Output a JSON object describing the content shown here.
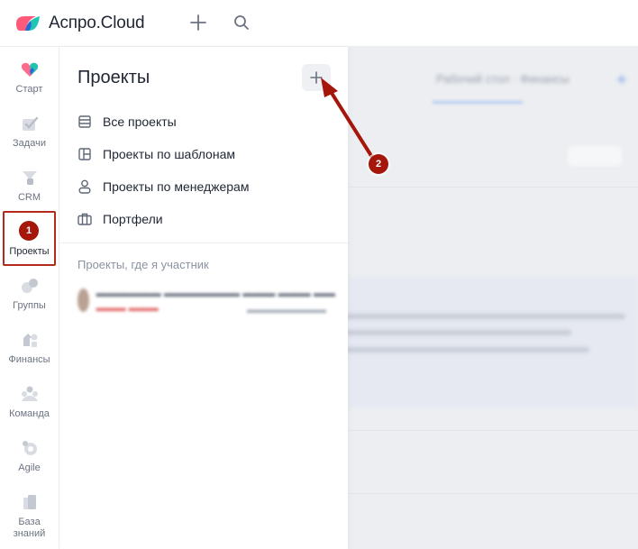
{
  "header": {
    "app_name": "Аспро.Cloud",
    "plus_icon": "plus-icon",
    "search_icon": "search-icon"
  },
  "rail": {
    "items": [
      {
        "label": "Старт",
        "icon": "heart-start-icon"
      },
      {
        "label": "Задачи",
        "icon": "tasks-icon"
      },
      {
        "label": "CRM",
        "icon": "crm-funnel-icon"
      },
      {
        "label": "Проекты",
        "icon": "projects-icon"
      },
      {
        "label": "Группы",
        "icon": "groups-icon"
      },
      {
        "label": "Финансы",
        "icon": "finance-icon"
      },
      {
        "label": "Команда",
        "icon": "team-icon"
      },
      {
        "label": "Agile",
        "icon": "agile-icon"
      },
      {
        "label": "База знаний",
        "icon": "knowledge-base-icon"
      }
    ]
  },
  "panel": {
    "title": "Проекты",
    "nav": [
      {
        "label": "Все проекты",
        "icon": "list-icon"
      },
      {
        "label": "Проекты по шаблонам",
        "icon": "template-icon"
      },
      {
        "label": "Проекты по менеджерам",
        "icon": "user-icon"
      },
      {
        "label": "Портфели",
        "icon": "briefcase-icon"
      }
    ],
    "section_label": "Проекты, где я участник"
  },
  "annotations": {
    "badge_1": "1",
    "badge_2": "2",
    "color": "#a5160b"
  },
  "colors": {
    "accent_blue": "#3b82f6",
    "text_primary": "#1f2533",
    "text_muted": "#6b7280"
  }
}
